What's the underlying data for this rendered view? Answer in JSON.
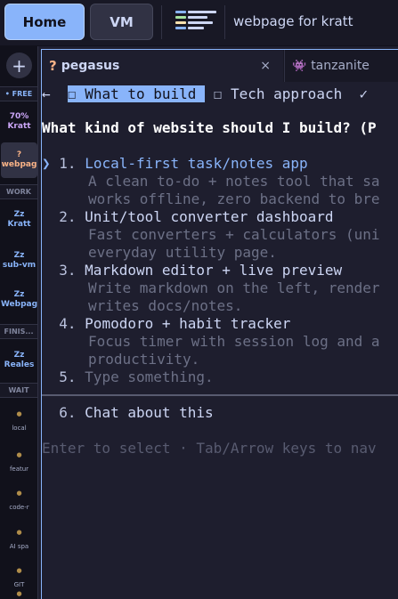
{
  "topbar": {
    "home_label": "Home",
    "vm_label": "VM",
    "title": "webpage for kratt"
  },
  "sidebar": {
    "add_label": "+",
    "sections": {
      "free": "• FREE",
      "work": "WORK",
      "finished": "FINIS...",
      "wait": "WAIT"
    },
    "free_items": [
      {
        "line1": "70%",
        "line2": "Kratt"
      },
      {
        "line1": "?",
        "line2": "webpag"
      }
    ],
    "work_items": [
      {
        "line1": "Zz",
        "line2": "Kratt"
      },
      {
        "line1": "Zz",
        "line2": "sub-vm"
      },
      {
        "line1": "Zz",
        "line2": "Webpag"
      }
    ],
    "finished_items": [
      {
        "line1": "Zz",
        "line2": "Reales"
      }
    ],
    "wait_items": [
      {
        "dot": "●",
        "label": "local"
      },
      {
        "dot": "●",
        "label": "featur"
      },
      {
        "dot": "●",
        "label": "code-r"
      },
      {
        "dot": "●",
        "label": "AI spa"
      },
      {
        "dot": "●",
        "label": "GIT"
      },
      {
        "dot": "●",
        "label": ""
      }
    ]
  },
  "tabs": [
    {
      "icon": "?",
      "label": "pegasus",
      "close": "×"
    },
    {
      "icon": "👾",
      "label": "tanzanite"
    }
  ],
  "terminal": {
    "back_arrow": "←",
    "step1_box": "☐",
    "step1": "What to build",
    "step2_box": "☐",
    "step2": "Tech approach",
    "step3_check": "✓",
    "question": "What kind of website should I build? (P",
    "pointer": "❯",
    "options": [
      {
        "num": "1.",
        "title": "Local-first task/notes app",
        "desc": [
          "A clean to-do + notes tool that sa",
          "works offline, zero backend to bre"
        ]
      },
      {
        "num": "2.",
        "title": "Unit/tool converter dashboard",
        "desc": [
          "Fast converters + calculators (uni",
          "everyday utility page."
        ]
      },
      {
        "num": "3.",
        "title": "Markdown editor + live preview",
        "desc": [
          "Write markdown on the left, render",
          "writes docs/notes."
        ]
      },
      {
        "num": "4.",
        "title": "Pomodoro + habit tracker",
        "desc": [
          "Focus timer with session log and a",
          "productivity."
        ]
      },
      {
        "num": "5.",
        "title": "Type something."
      }
    ],
    "chat_option": {
      "num": "6.",
      "title": "Chat about this"
    },
    "footer": "Enter to select · Tab/Arrow keys to nav"
  },
  "colors": {
    "accent": "#89b4fa",
    "background": "#1e1e2e",
    "muted": "#6c7086"
  }
}
